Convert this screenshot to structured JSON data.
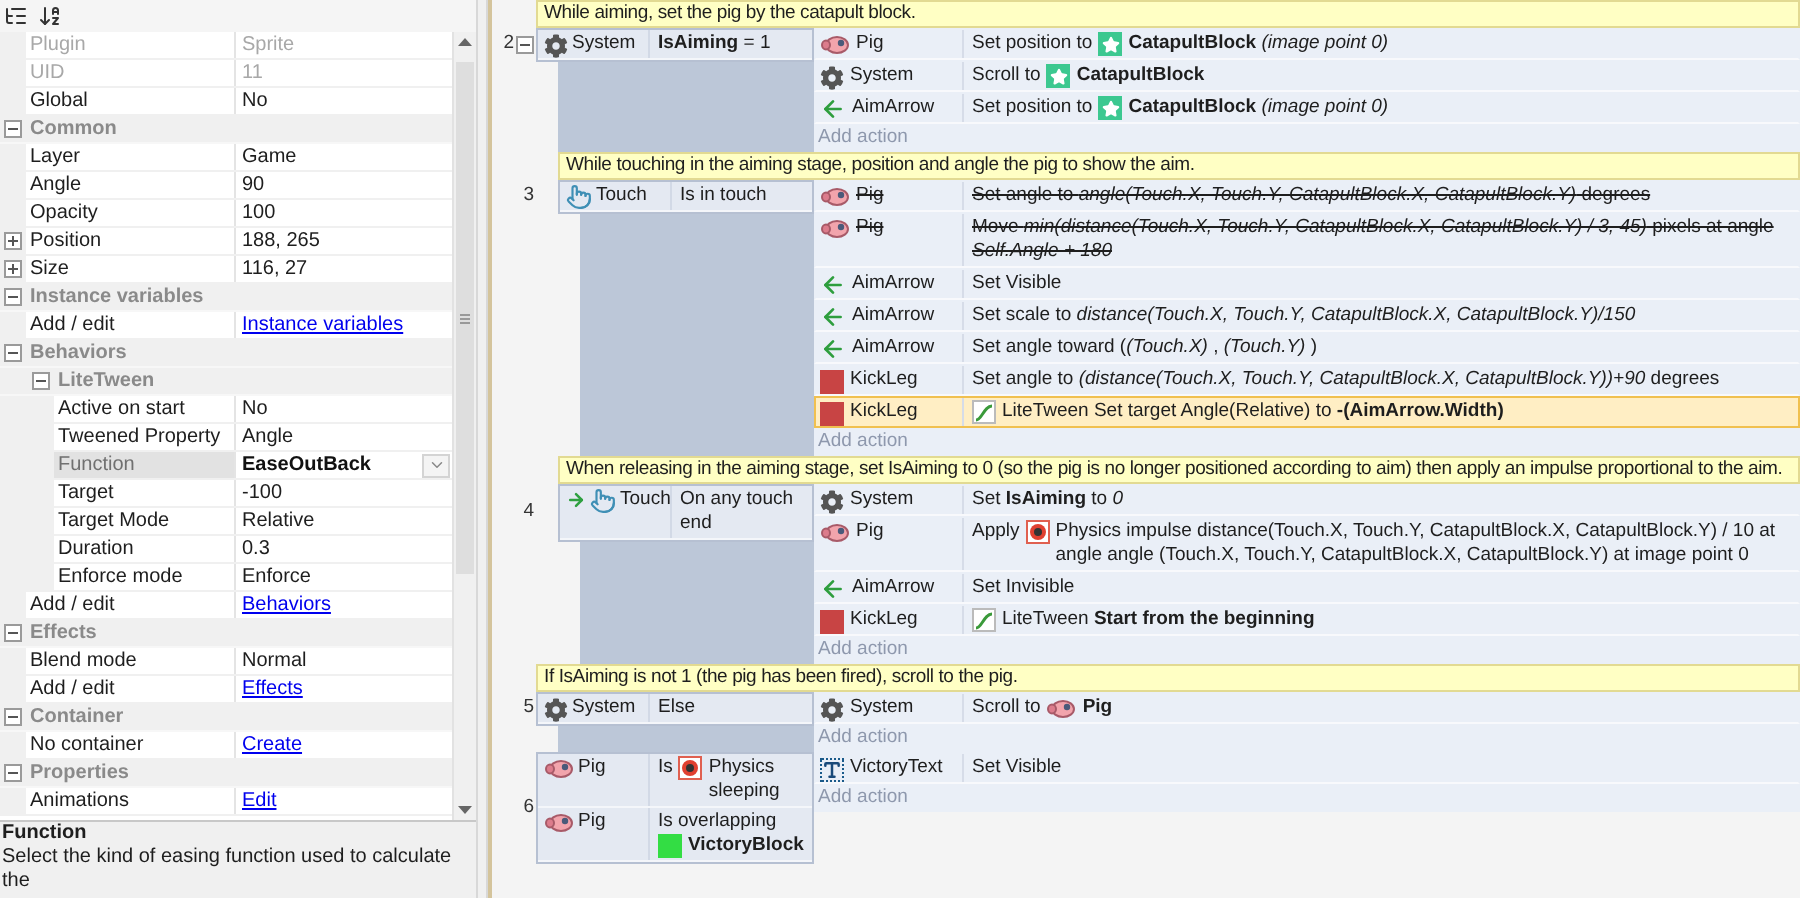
{
  "properties": [
    {
      "kind": "text",
      "name": "Plugin",
      "value": "Sprite",
      "disabled": true,
      "selected": false
    },
    {
      "kind": "text",
      "name": "UID",
      "value": "11",
      "disabled": true,
      "selected": false
    },
    {
      "kind": "text",
      "name": "Global",
      "value": "No",
      "disabled": false,
      "selected": false
    },
    {
      "kind": "category",
      "name": "Common",
      "expanded": true,
      "children": [
        {
          "kind": "text",
          "name": "Layer",
          "value": "Game",
          "disabled": false,
          "selected": false
        },
        {
          "kind": "text",
          "name": "Angle",
          "value": "90",
          "disabled": false,
          "selected": false
        },
        {
          "kind": "text",
          "name": "Opacity",
          "value": "100",
          "disabled": false,
          "selected": false
        },
        {
          "kind": "text",
          "name": "Position",
          "value": "188, 265",
          "disabled": false,
          "selected": false,
          "expanded": false
        },
        {
          "kind": "text",
          "name": "Size",
          "value": "116, 27",
          "disabled": false,
          "selected": false,
          "expanded": false
        }
      ]
    },
    {
      "kind": "category",
      "name": "Instance variables",
      "expanded": true,
      "children": [
        {
          "kind": "link",
          "name": "Add / edit",
          "value": "Instance variables",
          "disabled": false,
          "selected": false
        }
      ]
    },
    {
      "kind": "category",
      "name": "Behaviors",
      "expanded": true,
      "children": [
        {
          "kind": "category",
          "name": "LiteTween",
          "expanded": true,
          "children": [
            {
              "kind": "text",
              "name": "Active on start",
              "value": "No",
              "disabled": false,
              "selected": false
            },
            {
              "kind": "text",
              "name": "Tweened Property",
              "value": "Angle",
              "disabled": false,
              "selected": false
            },
            {
              "kind": "dropdown",
              "name": "Function",
              "value": "EaseOutBack",
              "disabled": false,
              "selected": true
            },
            {
              "kind": "text",
              "name": "Target",
              "value": "-100",
              "disabled": false,
              "selected": false
            },
            {
              "kind": "text",
              "name": "Target Mode",
              "value": "Relative",
              "disabled": false,
              "selected": false
            },
            {
              "kind": "text",
              "name": "Duration",
              "value": "0.3",
              "disabled": false,
              "selected": false
            },
            {
              "kind": "text",
              "name": "Enforce mode",
              "value": "Enforce",
              "disabled": false,
              "selected": false
            }
          ]
        },
        {
          "kind": "link",
          "name": "Add / edit",
          "value": "Behaviors",
          "disabled": false,
          "selected": false
        }
      ]
    },
    {
      "kind": "category",
      "name": "Effects",
      "expanded": true,
      "children": [
        {
          "kind": "text",
          "name": "Blend mode",
          "value": "Normal",
          "disabled": false,
          "selected": false
        },
        {
          "kind": "link",
          "name": "Add / edit",
          "value": "Effects",
          "disabled": false,
          "selected": false
        }
      ]
    },
    {
      "kind": "category",
      "name": "Container",
      "expanded": true,
      "children": [
        {
          "kind": "link",
          "name": "No container",
          "value": "Create",
          "disabled": false,
          "selected": false
        }
      ]
    },
    {
      "kind": "category",
      "name": "Properties",
      "expanded": true,
      "children": [
        {
          "kind": "link",
          "name": "Animations",
          "value": "Edit",
          "disabled": false,
          "selected": false
        }
      ]
    }
  ],
  "help": {
    "title": "Function",
    "text": "Select the kind of easing function used to calculate the"
  },
  "events": [
    {
      "number": "2",
      "expanded": true,
      "comment": "While aiming, set the pig by the catapult block.",
      "conditions": [
        {
          "object": "System",
          "kind": "gear",
          "trigger": false,
          "parts": [
            {
              "kind": "text",
              "text": "**IsAiming** = 1"
            }
          ]
        }
      ],
      "actions": [
        {
          "object": "Pig",
          "kind": "pig",
          "disabled": false,
          "selected": false,
          "parts": [
            {
              "kind": "text",
              "text": "Set position to"
            },
            {
              "kind": "star"
            },
            {
              "kind": "text",
              "text": "**CatapultBlock** *(image point 0)*"
            }
          ]
        },
        {
          "object": "System",
          "kind": "gear",
          "disabled": false,
          "selected": false,
          "parts": [
            {
              "kind": "text",
              "text": "Scroll to"
            },
            {
              "kind": "star"
            },
            {
              "kind": "text",
              "text": "**CatapultBlock**"
            }
          ]
        },
        {
          "object": "AimArrow",
          "kind": "arrow",
          "disabled": false,
          "selected": false,
          "parts": [
            {
              "kind": "text",
              "text": "Set position to"
            },
            {
              "kind": "star"
            },
            {
              "kind": "text",
              "text": "**CatapultBlock** *(image point 0)*"
            }
          ]
        }
      ],
      "add_action": "Add action",
      "children": [
        {
          "number": "3",
          "comment": "While touching in the aiming stage, position and angle the pig to show the aim.",
          "conditions": [
            {
              "object": "Touch",
              "kind": "touch",
              "trigger": false,
              "parts": [
                {
                  "kind": "text",
                  "text": "Is in touch"
                }
              ]
            }
          ],
          "actions": [
            {
              "object": "Pig",
              "kind": "pig",
              "disabled": true,
              "selected": false,
              "parts": [
                {
                  "kind": "text",
                  "text": "Set angle to *angle(Touch.X, Touch.Y, CatapultBlock.X, CatapultBlock.Y)* degrees"
                }
              ]
            },
            {
              "object": "Pig",
              "kind": "pig",
              "disabled": true,
              "selected": false,
              "parts": [
                {
                  "kind": "text",
                  "text": "Move *min(distance(Touch.X, Touch.Y, CatapultBlock.X, CatapultBlock.Y) / 3, 45)* pixels at angle *Self.Angle + 180*"
                }
              ]
            },
            {
              "object": "AimArrow",
              "kind": "arrow",
              "disabled": false,
              "selected": false,
              "parts": [
                {
                  "kind": "text",
                  "text": "Set Visible"
                }
              ]
            },
            {
              "object": "AimArrow",
              "kind": "arrow",
              "disabled": false,
              "selected": false,
              "parts": [
                {
                  "kind": "text",
                  "text": "Set scale to *distance(Touch.X, Touch.Y, CatapultBlock.X, CatapultBlock.Y)/150*"
                }
              ]
            },
            {
              "object": "AimArrow",
              "kind": "arrow",
              "disabled": false,
              "selected": false,
              "parts": [
                {
                  "kind": "text",
                  "text": "Set angle toward (*(Touch.X)* , *(Touch.Y)* )"
                }
              ]
            },
            {
              "object": "KickLeg",
              "kind": "block",
              "disabled": false,
              "selected": false,
              "parts": [
                {
                  "kind": "text",
                  "text": "Set angle to *(distance(Touch.X, Touch.Y, CatapultBlock.X, CatapultBlock.Y))+90* degrees"
                }
              ]
            },
            {
              "object": "KickLeg",
              "kind": "block",
              "disabled": false,
              "selected": true,
              "parts": [
                {
                  "kind": "tween"
                },
                {
                  "kind": "text",
                  "text": "LiteTween Set target Angle(Relative) to **-(AimArrow.Width)**"
                }
              ]
            }
          ],
          "add_action": "Add action"
        },
        {
          "number": "4",
          "comment": "When releasing in the aiming stage, set IsAiming to 0 (so the pig is no longer positioned according to aim) then apply an impulse proportional to the aim.",
          "conditions": [
            {
              "object": "Touch",
              "kind": "touch",
              "trigger": true,
              "parts": [
                {
                  "kind": "text",
                  "text": "On any touch end"
                }
              ]
            }
          ],
          "actions": [
            {
              "object": "System",
              "kind": "gear",
              "disabled": false,
              "selected": false,
              "parts": [
                {
                  "kind": "text",
                  "text": "Set **IsAiming** to *0*"
                }
              ]
            },
            {
              "object": "Pig",
              "kind": "pig",
              "disabled": false,
              "selected": false,
              "parts": [
                {
                  "kind": "text",
                  "text": "Apply"
                },
                {
                  "kind": "physics"
                },
                {
                  "kind": "text",
                  "text": "Physics impulse distance(Touch.X, Touch.Y, CatapultBlock.X, CatapultBlock.Y) / 10 at angle angle (Touch.X, Touch.Y, CatapultBlock.X, CatapultBlock.Y) at image point 0"
                }
              ]
            },
            {
              "object": "AimArrow",
              "kind": "arrow",
              "disabled": false,
              "selected": false,
              "parts": [
                {
                  "kind": "text",
                  "text": "Set Invisible"
                }
              ]
            },
            {
              "object": "KickLeg",
              "kind": "block",
              "disabled": false,
              "selected": false,
              "parts": [
                {
                  "kind": "tween"
                },
                {
                  "kind": "text",
                  "text": "LiteTween **Start from the beginning**"
                }
              ]
            }
          ],
          "add_action": "Add action"
        }
      ]
    },
    {
      "number": "5",
      "comment": "If IsAiming is not 1 (the pig has been fired), scroll to the pig.",
      "conditions": [
        {
          "object": "System",
          "kind": "gear",
          "trigger": false,
          "parts": [
            {
              "kind": "text",
              "text": "Else"
            }
          ]
        }
      ],
      "actions": [
        {
          "object": "System",
          "kind": "gear",
          "disabled": false,
          "selected": false,
          "parts": [
            {
              "kind": "text",
              "text": "Scroll to"
            },
            {
              "kind": "pig"
            },
            {
              "kind": "text",
              "text": "**Pig**"
            }
          ]
        }
      ],
      "add_action": "Add action"
    },
    {
      "number": "6",
      "conditions": [
        {
          "object": "Pig",
          "kind": "pig",
          "trigger": false,
          "parts": [
            {
              "kind": "text",
              "text": "Is"
            },
            {
              "kind": "physics"
            },
            {
              "kind": "text",
              "text": "Physics sleeping"
            }
          ]
        },
        {
          "object": "Pig",
          "kind": "pig",
          "trigger": false,
          "parts": [
            {
              "kind": "text",
              "text": "Is overlapping"
            },
            {
              "kind": "block"
            },
            {
              "kind": "text",
              "text": "**VictoryBlock**"
            }
          ]
        }
      ],
      "actions": [
        {
          "object": "VictoryText",
          "kind": "text",
          "disabled": false,
          "selected": false,
          "parts": [
            {
              "kind": "text",
              "text": "Set Visible"
            }
          ]
        }
      ],
      "add_action": "Add action"
    }
  ]
}
